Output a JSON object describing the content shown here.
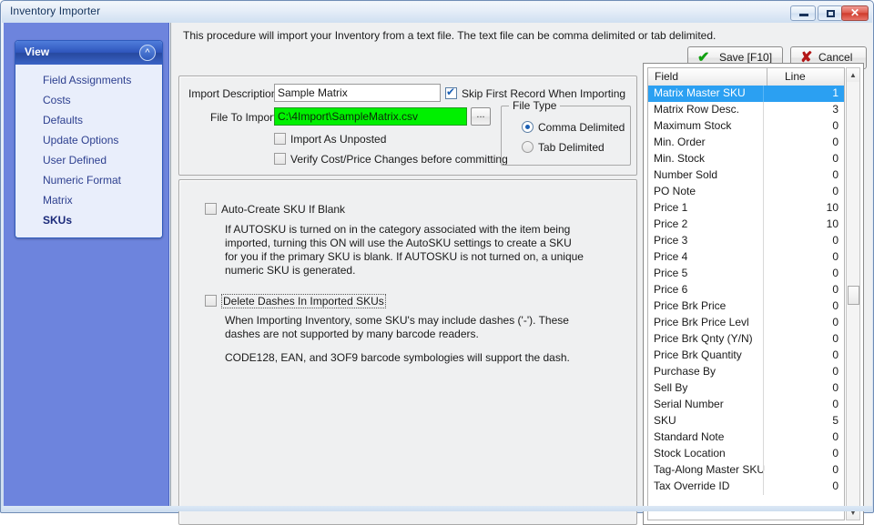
{
  "window": {
    "title": "Inventory Importer",
    "controls": {
      "minimize": "minimize-button",
      "maximize": "maximize-button",
      "close_glyph": "✕"
    }
  },
  "sidebar": {
    "panel_title": "View",
    "collapse_glyph": "«",
    "items": [
      {
        "label": "Field Assignments",
        "active": false
      },
      {
        "label": "Costs",
        "active": false
      },
      {
        "label": "Defaults",
        "active": false
      },
      {
        "label": "Update Options",
        "active": false
      },
      {
        "label": "User Defined",
        "active": false
      },
      {
        "label": "Numeric Format",
        "active": false
      },
      {
        "label": "Matrix",
        "active": false
      },
      {
        "label": "SKUs",
        "active": true
      }
    ]
  },
  "header": {
    "intro": "This procedure will import your Inventory from a text file.  The text file can be comma delimited or tab delimited.",
    "save_label": "Save [F10]",
    "save_glyph": "✔",
    "cancel_label": "Cancel",
    "cancel_glyph": "✘"
  },
  "form": {
    "import_description_label": "Import Description:",
    "import_description_value": "Sample Matrix",
    "import_description_placeholder": "",
    "file_to_import_label": "File To Import:",
    "file_to_import_value": "C:\\4Import\\SampleMatrix.csv",
    "file_to_import_placeholder": "",
    "browse_label": "...",
    "import_as_unposted_label": "Import As Unposted",
    "verify_changes_label": "Verify Cost/Price Changes before committing",
    "skip_first_record_label": "Skip First Record When Importing",
    "file_type": {
      "group_title": "File Type",
      "options": [
        {
          "label": "Comma Delimited",
          "selected": true
        },
        {
          "label": "Tab Delimited",
          "selected": false
        }
      ]
    }
  },
  "sku_section": {
    "auto_create_label": "Auto-Create SKU If Blank",
    "auto_create_help": "If AUTOSKU is turned on in the category associated with the item being imported, turning this ON will use the AutoSKU settings to create a SKU for you if the primary SKU is blank.  If AUTOSKU is not turned on, a unique numeric SKU is generated.",
    "delete_dashes_label": "Delete Dashes In Imported SKUs",
    "delete_dashes_help_1": "When Importing Inventory, some SKU's may include dashes ('-').  These dashes are not supported by many barcode readers.",
    "delete_dashes_help_2": "CODE128, EAN, and 3OF9 barcode symbologies will support the dash."
  },
  "field_table": {
    "columns": [
      "Field",
      "Line"
    ],
    "scroll_up_glyph": "▲",
    "scroll_down_glyph": "▼",
    "rows": [
      {
        "field": "Matrix Master SKU",
        "line": "1",
        "selected": true
      },
      {
        "field": "Matrix Row Desc.",
        "line": "3",
        "selected": false
      },
      {
        "field": "Maximum Stock",
        "line": "0",
        "selected": false
      },
      {
        "field": "Min. Order",
        "line": "0",
        "selected": false
      },
      {
        "field": "Min. Stock",
        "line": "0",
        "selected": false
      },
      {
        "field": "Number Sold",
        "line": "0",
        "selected": false
      },
      {
        "field": "PO Note",
        "line": "0",
        "selected": false
      },
      {
        "field": "Price 1",
        "line": "10",
        "selected": false
      },
      {
        "field": "Price 2",
        "line": "10",
        "selected": false
      },
      {
        "field": "Price 3",
        "line": "0",
        "selected": false
      },
      {
        "field": "Price 4",
        "line": "0",
        "selected": false
      },
      {
        "field": "Price 5",
        "line": "0",
        "selected": false
      },
      {
        "field": "Price 6",
        "line": "0",
        "selected": false
      },
      {
        "field": "Price Brk Price",
        "line": "0",
        "selected": false
      },
      {
        "field": "Price Brk Price Levl",
        "line": "0",
        "selected": false
      },
      {
        "field": "Price Brk Qnty (Y/N)",
        "line": "0",
        "selected": false
      },
      {
        "field": "Price Brk Quantity",
        "line": "0",
        "selected": false
      },
      {
        "field": "Purchase By",
        "line": "0",
        "selected": false
      },
      {
        "field": "Sell By",
        "line": "0",
        "selected": false
      },
      {
        "field": "Serial Number",
        "line": "0",
        "selected": false
      },
      {
        "field": "SKU",
        "line": "5",
        "selected": false
      },
      {
        "field": "Standard Note",
        "line": "0",
        "selected": false
      },
      {
        "field": "Stock Location",
        "line": "0",
        "selected": false
      },
      {
        "field": "Tag-Along Master SKU",
        "line": "0",
        "selected": false
      },
      {
        "field": "Tax Override ID",
        "line": "0",
        "selected": false
      }
    ]
  },
  "colors": {
    "sidebar": "#6d84dd",
    "panel_header": "#2f56bd",
    "selection": "#2ba0f2",
    "file_input": "#00f000",
    "save_check": "#11a011",
    "cancel_x": "#b31616"
  }
}
